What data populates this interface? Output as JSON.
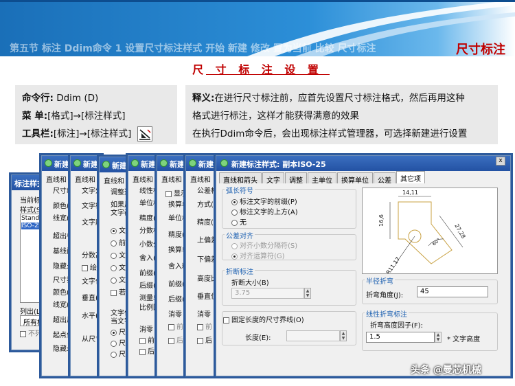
{
  "header": {
    "ghost_text": "第五节 标注 Ddim命令 1 设置尺寸标注样式 开始 新建 修改 置为当前 比较 尺寸标注",
    "section_title": "尺寸标注",
    "subtitle": "尺 寸 标 注 设 置"
  },
  "left_panel": {
    "cmd_label": "命令行:",
    "cmd_value": "Ddim (D)",
    "menu_label": "菜 单:",
    "menu_value": "[格式]→[标注样式]",
    "toolbar_label": "工具栏:",
    "toolbar_value": "[标注]→[标注样式]"
  },
  "right_panel": {
    "label": "释义:",
    "line1": "在进行尺寸标注前，应首先设置尺寸标注格式，然后再用这种",
    "line2": "格式进行标注，这样才能获得满意的效果",
    "line3": "在执行Ddim命令后，会出现标注样式管理器，可选择新建进行设置"
  },
  "bg_dialogs": {
    "manager": {
      "title": "标注样式",
      "current": "当前标",
      "styles": "样式(S",
      "items": [
        "Standa",
        "ISO-25"
      ],
      "list": "列出(L",
      "list_value": "所有样",
      "no_list": "不列"
    },
    "d1": {
      "title": "新建",
      "tab": "直线和",
      "rows": [
        "尺寸线",
        "颜色(",
        "线宽(",
        "超出标",
        "基线间",
        "隐藏:",
        "尺寸界",
        "颜色(",
        "线宽(",
        "超出尺",
        "起点偏",
        "隐藏:"
      ]
    },
    "d2": {
      "title": "新建",
      "tab": "直线和",
      "rows": [
        "文字外",
        "文字样",
        "文字颜",
        "分数高",
        "绘",
        "文字位",
        "垂直(",
        "水平(",
        "从尺寸"
      ]
    },
    "d3": {
      "title": "新建",
      "tab": "直线和",
      "rows": [
        "调整选",
        "如果尺",
        "文字都",
        "文",
        "前",
        "文",
        "文",
        "文",
        "若",
        "文字位",
        "当文字",
        "尺",
        "尺",
        "尺"
      ]
    },
    "d4": {
      "title": "新建",
      "tab": "直线和",
      "rows": [
        "线性标",
        "单位格",
        "精度(",
        "分数格",
        "小数分",
        "舍入(",
        "前缀(",
        "后缀(",
        "测量单",
        "比例因",
        "消零",
        "前",
        "后"
      ]
    },
    "d5": {
      "title": "新建",
      "tab": "直线和",
      "rows": [
        "显示",
        "换算单",
        "单位格",
        "精度(",
        "换算单",
        "舍入精",
        "前缀(",
        "后缀(",
        "消零",
        "前",
        "后"
      ]
    },
    "d6": {
      "title": "新建",
      "tab": "直线和",
      "rows": [
        "公差格",
        "方式(",
        "精度(",
        "上偏差",
        "下偏差",
        "高度比",
        "垂直位",
        "消零",
        "前",
        "后"
      ]
    }
  },
  "front_dialog": {
    "title": "新建标注样式: 副本ISO-25",
    "tabs": [
      "直线和箭头",
      "文字",
      "调整",
      "主单位",
      "换算单位",
      "公差",
      "其它项"
    ],
    "arc_group": "弧长符号",
    "arc_opts": [
      "标注文字的前缀(P)",
      "标注文字的上方(A)",
      "无"
    ],
    "tol_group": "公差对齐",
    "tol_opts": [
      "对齐小数分隔符(S)",
      "对齐运算符(G)"
    ],
    "break_group": "折断标注",
    "break_size_label": "折断大小(B)",
    "break_size_value": "3.75",
    "fixed_ext_label": "固定长度的尺寸界线(O)",
    "length_label": "长度(E):",
    "length_value": "",
    "radius_group": "半径折弯",
    "jog_angle_label": "折弯角度(J):",
    "jog_angle_value": "45",
    "linear_group": "线性折弯标注",
    "jog_factor_label": "折弯高度因子(F):",
    "jog_factor_value": "1.5",
    "jog_factor_unit": "* 文字高度",
    "preview": {
      "d1": "14,11",
      "d2": "16,6",
      "d3": "27,28",
      "ang": "60°",
      "rad": "R11,17"
    },
    "close": "x"
  },
  "watermark": "头条 @曼芯机械",
  "colors": {
    "accent": "#c00000",
    "title_blue": "#2352a3",
    "group_blue": "#1b5fb0"
  }
}
